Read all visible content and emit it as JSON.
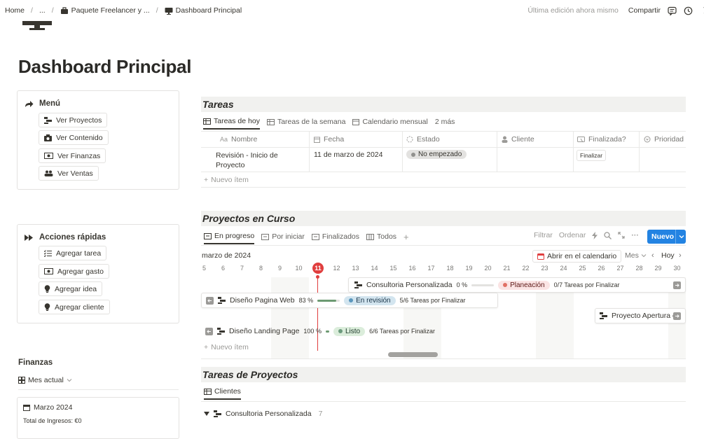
{
  "breadcrumb": {
    "home": "Home",
    "ellipsis": "...",
    "package": "Paquete Freelancer y ...",
    "current": "Dashboard Principal"
  },
  "topbar": {
    "last_edit": "Última edición ahora mismo",
    "share": "Compartir"
  },
  "page_title": "Dashboard Principal",
  "menu": {
    "title": "Menú",
    "items": [
      "Ver Proyectos",
      "Ver Contenido",
      "Ver Finanzas",
      "Ver Ventas"
    ]
  },
  "quick_actions": {
    "title": "Acciones rápidas",
    "items": [
      "Agregar tarea",
      "Agregar gasto",
      "Agregar idea",
      "Agregar cliente"
    ]
  },
  "finanzas": {
    "title": "Finanzas",
    "view": "Mes actual",
    "card_title": "Marzo 2024",
    "income": "Total de Ingresos: €0"
  },
  "tareas": {
    "title": "Tareas",
    "tabs": [
      "Tareas de hoy",
      "Tareas de la semana",
      "Calendario mensual",
      "2 más"
    ],
    "columns": [
      "Nombre",
      "Fecha",
      "Estado",
      "Cliente",
      "Finalizada?",
      "Prioridad"
    ],
    "row": {
      "name_line1": "Revisión - Inicio de",
      "name_line2": "Proyecto",
      "date": "11 de marzo de 2024",
      "status": "No empezado",
      "action": "Finalizar"
    },
    "new_item": "Nuevo ítem"
  },
  "proyectos": {
    "title": "Proyectos en Curso",
    "tabs": [
      "En progreso",
      "Por iniciar",
      "Finalizados",
      "Todos"
    ],
    "filter": "Filtrar",
    "sort": "Ordenar",
    "new_button": "Nuevo",
    "month": "marzo de 2024",
    "open_calendar": "Abrir en el calendario",
    "scale": "Mes",
    "today": "Hoy",
    "today_badge": "11",
    "days": [
      "5",
      "6",
      "7",
      "8",
      "9",
      "10",
      "11",
      "12",
      "13",
      "14",
      "15",
      "16",
      "17",
      "18",
      "19",
      "20",
      "21",
      "22",
      "23",
      "24",
      "25",
      "26",
      "27",
      "28",
      "29",
      "30"
    ],
    "bars": [
      {
        "name": "Consultoria Personalizada",
        "percent": "0 %",
        "progress": 0,
        "status": "Planeación",
        "tasks": "0/7 Tareas por Finalizar"
      },
      {
        "name": "Diseño Pagina Web",
        "percent": "83 %",
        "progress": 0.83,
        "status": "En revisión",
        "tasks": "5/6 Tareas por Finalizar"
      },
      {
        "name": "Proyecto Apertura e",
        "percent": "",
        "progress": null,
        "status": "",
        "tasks": ""
      },
      {
        "name": "Diseño Landing Page",
        "percent": "100 %",
        "progress": 1.0,
        "status": "Listo",
        "tasks": "6/6 Tareas por Finalizar"
      }
    ],
    "new_item": "Nuevo ítem"
  },
  "tareas_proyectos": {
    "title": "Tareas de Proyectos",
    "tab": "Clientes",
    "group": "Consultoria Personalizada",
    "group_count": "7"
  },
  "colors": {
    "accent_blue": "#2383e2",
    "today_red": "#e03e3e",
    "planeacion_bg": "#fbe4e4",
    "revision_bg": "#d3e5ef",
    "listo_bg": "#dbeddb",
    "no_empezado_bg": "#e3e2e0"
  }
}
